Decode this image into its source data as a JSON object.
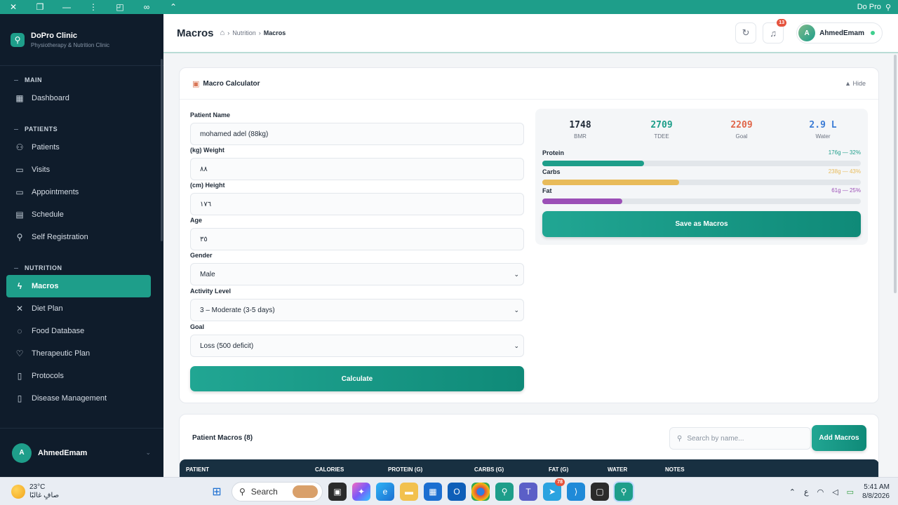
{
  "window": {
    "title": "Do Pro"
  },
  "brand": {
    "name": "DoPro Clinic",
    "subtitle": "Physiotherapy & Nutrition Clinic"
  },
  "sidebar": {
    "sections": [
      {
        "label": "MAIN",
        "items": [
          {
            "label": "Dashboard",
            "icon": "dashboard-icon"
          }
        ]
      },
      {
        "label": "PATIENTS",
        "items": [
          {
            "label": "Patients",
            "icon": "users-icon"
          },
          {
            "label": "Visits",
            "icon": "calendar-icon"
          },
          {
            "label": "Appointments",
            "icon": "calendar-check-icon"
          },
          {
            "label": "Schedule",
            "icon": "schedule-icon"
          },
          {
            "label": "Self Registration",
            "icon": "user-plus-icon"
          }
        ]
      },
      {
        "label": "NUTRITION",
        "items": [
          {
            "label": "Macros",
            "icon": "bolt-icon",
            "active": true
          },
          {
            "label": "Diet Plan",
            "icon": "utensils-icon"
          },
          {
            "label": "Food Database",
            "icon": "apple-icon"
          },
          {
            "label": "Therapeutic Plan",
            "icon": "heart-pulse-icon"
          },
          {
            "label": "Protocols",
            "icon": "clipboard-icon"
          },
          {
            "label": "Disease Management",
            "icon": "clipboard-list-icon"
          }
        ]
      }
    ],
    "user": {
      "initial": "A",
      "name": "AhmedEmam"
    }
  },
  "header": {
    "title": "Macros",
    "breadcrumb": [
      "Nutrition",
      "Macros"
    ],
    "notifications_count": "13",
    "user": {
      "initial": "A",
      "name": "AhmedEmam"
    }
  },
  "calculator": {
    "title": "Macro Calculator",
    "hide_label": "▲ Hide",
    "fields": {
      "patient_name": {
        "label": "Patient Name",
        "value": "mohamed adel (88kg)"
      },
      "weight": {
        "label": "(kg) Weight",
        "value": "٨٨"
      },
      "height": {
        "label": "(cm) Height",
        "value": "١٧٦"
      },
      "age": {
        "label": "Age",
        "value": "٣٥"
      },
      "gender": {
        "label": "Gender",
        "value": "Male"
      },
      "activity": {
        "label": "Activity Level",
        "value": "3 – Moderate (3-5 days)"
      },
      "goal": {
        "label": "Goal",
        "value": "Loss (500 deficit)"
      }
    },
    "calculate_label": "Calculate",
    "results": {
      "stats": [
        {
          "value": "1748",
          "label": "BMR",
          "color": "#1f2a37"
        },
        {
          "value": "2709",
          "label": "TDEE",
          "color": "#1e9e8a"
        },
        {
          "value": "2209",
          "label": "Goal",
          "color": "#e0664a"
        },
        {
          "value": "2.9 L",
          "label": "Water",
          "color": "#3a7bd5"
        }
      ],
      "macros": [
        {
          "label": "Protein",
          "value": "176g — 32%",
          "percent": 32,
          "color": "#1e9e8a"
        },
        {
          "label": "Carbs",
          "value": "238g — 43%",
          "percent": 43,
          "color": "#e8bb5a"
        },
        {
          "label": "Fat",
          "value": "61g — 25%",
          "percent": 25,
          "color": "#9b4fb6"
        }
      ],
      "save_label": "Save as Macros"
    }
  },
  "patient_macros": {
    "title": "Patient Macros (8)",
    "search_placeholder": "Search by name...",
    "add_label": "Add Macros",
    "columns": [
      "PATIENT",
      "CALORIES",
      "PROTEIN (G)",
      "CARBS (G)",
      "FAT (G)",
      "WATER",
      "NOTES"
    ]
  },
  "taskbar": {
    "weather_temp": "23°C",
    "weather_desc": "صافٍ غالبًا",
    "search_label": "Search",
    "telegram_badge": "78",
    "lang": "ع",
    "time": "5:41 AM",
    "date": "8/8/2026"
  }
}
